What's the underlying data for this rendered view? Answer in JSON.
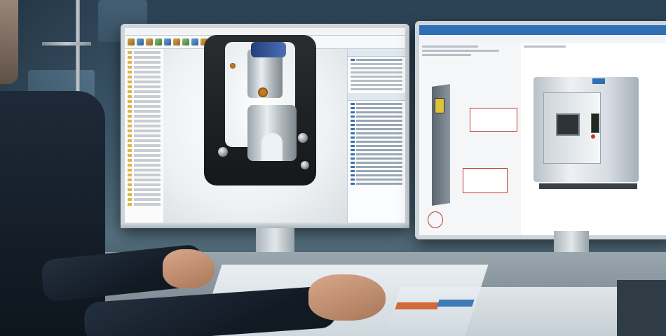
{
  "scene": {
    "description_colors": {
      "accent_blue": "#2f6fb6",
      "cad_bracket": "#1f2225",
      "highlight_orange": "#c87a1e",
      "callout_red": "#c0392b"
    }
  },
  "left_monitor": {
    "app_icons": [
      "folder-icon",
      "part-icon",
      "assembly-icon",
      "feature-icon"
    ]
  },
  "right_monitor": {
    "icons": [
      "machine-icon",
      "callout-icon",
      "toolbar-icon"
    ]
  }
}
